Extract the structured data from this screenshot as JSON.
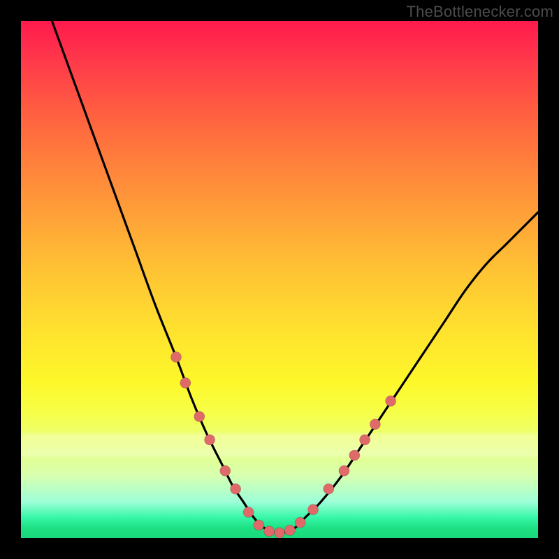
{
  "watermark": "TheBottlenecker.com",
  "colors": {
    "frame": "#000000",
    "gradient_top": "#ff1a4d",
    "gradient_mid": "#ffe22e",
    "gradient_bottom": "#19d97c",
    "curve": "#000000",
    "marker": "#e06a6a"
  },
  "chart_data": {
    "type": "line",
    "title": "",
    "xlabel": "",
    "ylabel": "",
    "xlim": [
      0,
      100
    ],
    "ylim": [
      0,
      100
    ],
    "series": [
      {
        "name": "bottleneck-curve",
        "x": [
          6,
          10,
          14,
          18,
          22,
          26,
          30,
          33,
          36,
          39,
          41,
          43,
          45,
          47,
          50,
          53,
          55,
          58,
          62,
          66,
          70,
          74,
          78,
          82,
          86,
          90,
          94,
          98,
          100
        ],
        "y": [
          100,
          89,
          78,
          67,
          56,
          45,
          35,
          27,
          20,
          14,
          10,
          7,
          4,
          2,
          1,
          2,
          4,
          7,
          12,
          18,
          24,
          30,
          36,
          42,
          48,
          53,
          57,
          61,
          63
        ]
      }
    ],
    "markers": [
      {
        "x": 30.0,
        "y": 35.0
      },
      {
        "x": 31.8,
        "y": 30.0
      },
      {
        "x": 34.5,
        "y": 23.5
      },
      {
        "x": 36.5,
        "y": 19.0
      },
      {
        "x": 39.5,
        "y": 13.0
      },
      {
        "x": 41.5,
        "y": 9.5
      },
      {
        "x": 44.0,
        "y": 5.0
      },
      {
        "x": 46.0,
        "y": 2.5
      },
      {
        "x": 48.0,
        "y": 1.3
      },
      {
        "x": 50.0,
        "y": 1.0
      },
      {
        "x": 52.0,
        "y": 1.5
      },
      {
        "x": 54.0,
        "y": 3.0
      },
      {
        "x": 56.5,
        "y": 5.5
      },
      {
        "x": 59.5,
        "y": 9.5
      },
      {
        "x": 62.5,
        "y": 13.0
      },
      {
        "x": 64.5,
        "y": 16.0
      },
      {
        "x": 66.5,
        "y": 19.0
      },
      {
        "x": 68.5,
        "y": 22.0
      },
      {
        "x": 71.5,
        "y": 26.5
      }
    ],
    "pale_band_y": 18
  }
}
